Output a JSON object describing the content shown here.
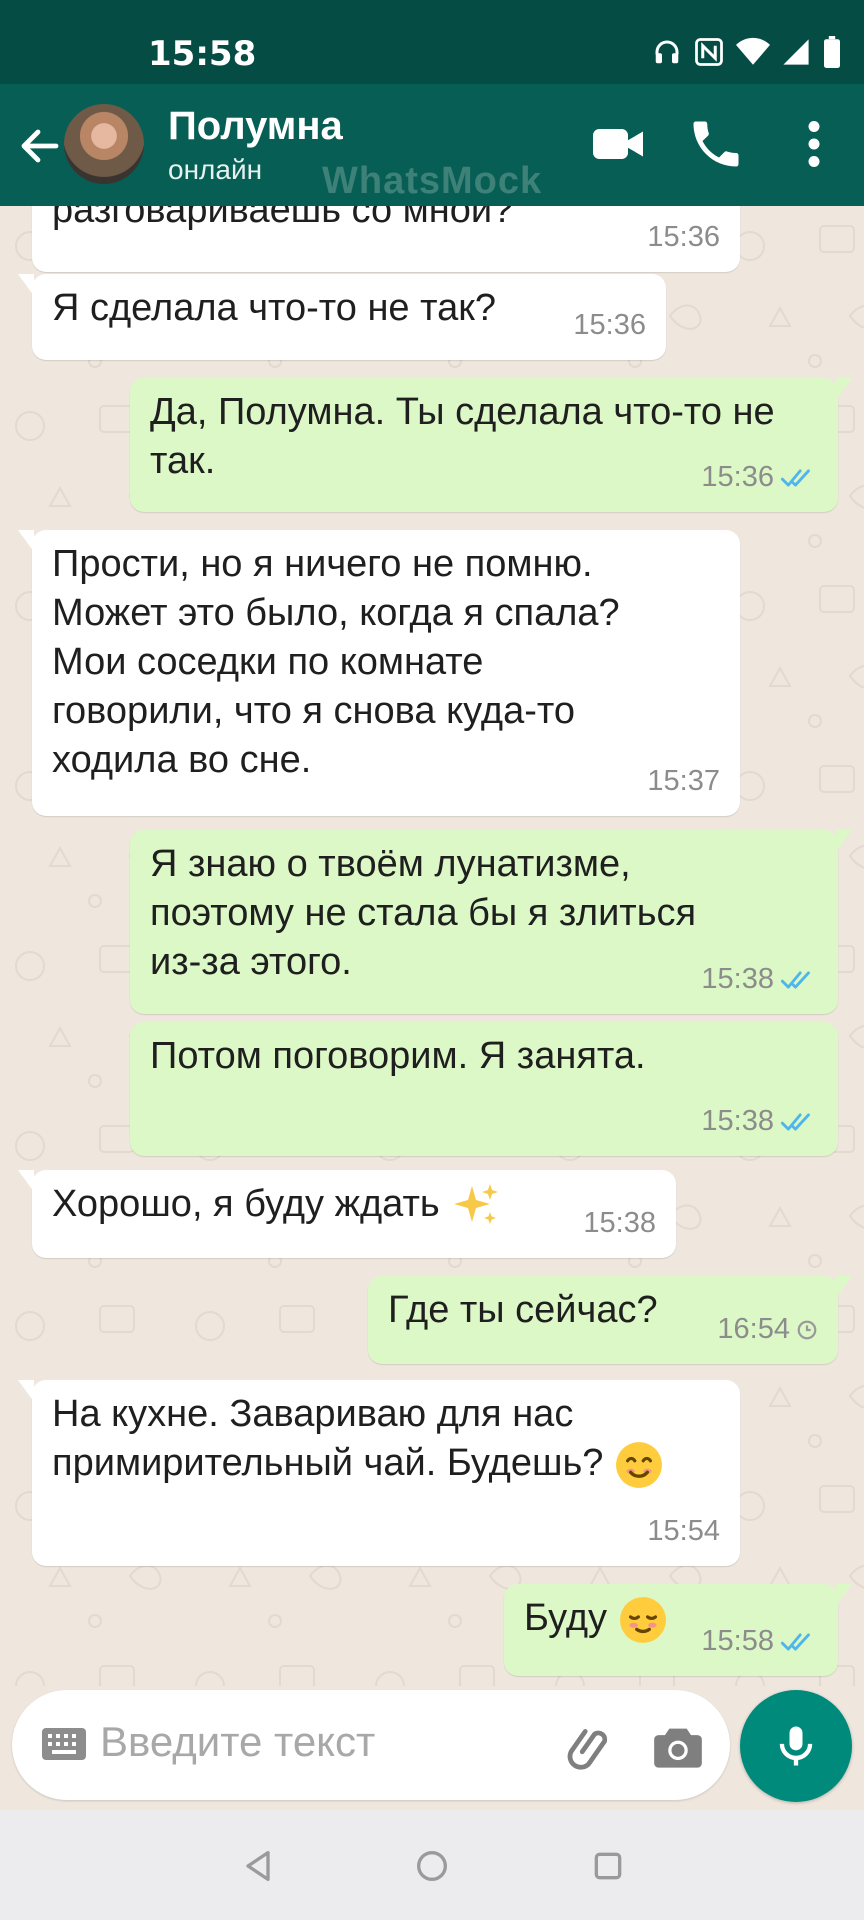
{
  "status_bar": {
    "time": "15:58",
    "icons": [
      "headphones-icon",
      "nfc-icon",
      "wifi-icon",
      "signal-icon",
      "battery-icon"
    ]
  },
  "header": {
    "contact_name": "Полумна",
    "status": "онлайн",
    "watermark": "WhatsMock",
    "icons": [
      "back-arrow-icon",
      "video-call-icon",
      "phone-icon",
      "more-vert-icon"
    ]
  },
  "messages": [
    {
      "dir": "in",
      "lines": [
        "разговариваешь со мной?"
      ],
      "time": "15:36"
    },
    {
      "dir": "in",
      "lines": [
        "Я сделала что-то не так?"
      ],
      "time": "15:36"
    },
    {
      "dir": "out",
      "lines": [
        "Да, Полумна. Ты сделала что-то не",
        "так."
      ],
      "time": "15:36",
      "status": "read"
    },
    {
      "dir": "in",
      "lines": [
        "Прости, но я ничего не помню.",
        "Может это было, когда я спала?",
        "Мои соседки по комнате",
        "говорили, что я снова куда-то",
        "ходила во сне."
      ],
      "time": "15:37"
    },
    {
      "dir": "out",
      "lines": [
        "Я знаю о твоём лунатизме,",
        "поэтому не стала бы я злиться",
        "из-за этого."
      ],
      "time": "15:38",
      "status": "read"
    },
    {
      "dir": "out",
      "lines": [
        "Потом поговорим. Я занята."
      ],
      "time": "15:38",
      "status": "read"
    },
    {
      "dir": "in",
      "lines": [
        "Хорошо, я буду ждать"
      ],
      "emoji": "sparkles-emoji",
      "time": "15:38"
    },
    {
      "dir": "out",
      "lines": [
        "Где ты сейчас?"
      ],
      "time": "16:54",
      "status": "pending"
    },
    {
      "dir": "in",
      "lines": [
        "На кухне. Завариваю для нас",
        "примирительный чай. Будешь?"
      ],
      "emoji": "smiling-face-emoji",
      "time": "15:54"
    },
    {
      "dir": "out",
      "lines": [
        "Буду"
      ],
      "emoji": "relieved-face-emoji",
      "time": "15:58",
      "status": "read"
    }
  ],
  "input": {
    "placeholder": "Введите текст",
    "icons": [
      "keyboard-icon",
      "paperclip-icon",
      "camera-icon",
      "mic-icon"
    ]
  },
  "nav_bar": {
    "icons": [
      "nav-back-icon",
      "nav-home-icon",
      "nav-recents-icon"
    ]
  },
  "colors": {
    "header": "#075e54",
    "status_bar": "#054d44",
    "chat_background": "#efe7de",
    "outgoing_bubble": "#dcf8c6",
    "incoming_bubble": "#ffffff",
    "read_ticks": "#4fb6ec",
    "mic_button": "#008a7c"
  }
}
